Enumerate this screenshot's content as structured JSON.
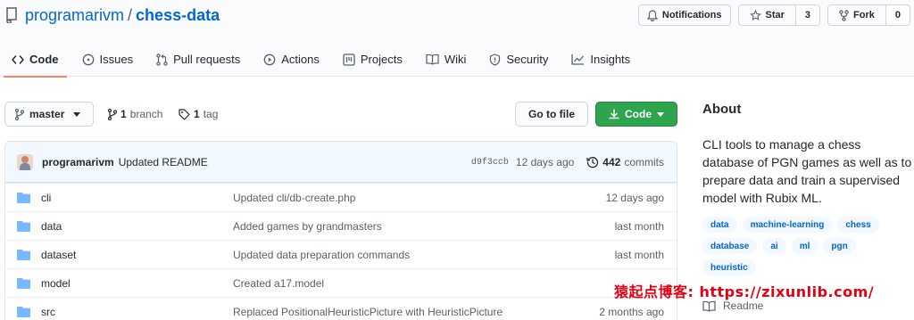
{
  "repo": {
    "owner": "programarivm",
    "separator": "/",
    "name": "chess-data"
  },
  "actions": {
    "notifications_label": "Notifications",
    "star_label": "Star",
    "star_count": "3",
    "fork_label": "Fork",
    "fork_count": "0"
  },
  "tabs": [
    {
      "label": "Code",
      "icon": "code-icon",
      "active": true
    },
    {
      "label": "Issues",
      "icon": "issue-icon"
    },
    {
      "label": "Pull requests",
      "icon": "pull-request-icon"
    },
    {
      "label": "Actions",
      "icon": "play-icon"
    },
    {
      "label": "Projects",
      "icon": "project-icon"
    },
    {
      "label": "Wiki",
      "icon": "book-icon"
    },
    {
      "label": "Security",
      "icon": "shield-icon"
    },
    {
      "label": "Insights",
      "icon": "graph-icon"
    }
  ],
  "toolbar": {
    "branch": "master",
    "branch_count": "1",
    "branch_word": "branch",
    "tag_count": "1",
    "tag_word": "tag",
    "goto_label": "Go to file",
    "code_label": "Code"
  },
  "latest_commit": {
    "user": "programarivm",
    "message": "Updated README",
    "sha": "d9f3ccb",
    "age": "12 days ago",
    "commit_count": "442",
    "commit_word": "commits"
  },
  "files": [
    {
      "name": "cli",
      "message": "Updated cli/db-create.php",
      "age": "12 days ago"
    },
    {
      "name": "data",
      "message": "Added games by grandmasters",
      "age": "last month"
    },
    {
      "name": "dataset",
      "message": "Updated data preparation commands",
      "age": "last month"
    },
    {
      "name": "model",
      "message": "Created a17.model",
      "age": ""
    },
    {
      "name": "src",
      "message": "Replaced PositionalHeuristicPicture with HeuristicPicture",
      "age": "2 months ago"
    }
  ],
  "about": {
    "title": "About",
    "description": "CLI tools to manage a chess database of PGN games as well as to prepare data and train a supervised model with Rubix ML.",
    "topics": [
      "data",
      "machine-learning",
      "chess",
      "database",
      "ai",
      "ml",
      "pgn",
      "heuristic"
    ],
    "readme_label": "Readme"
  },
  "watermark": "猿起点博客: https://zixunlib.com/",
  "colors": {
    "link": "#0366d6",
    "code_button": "#2ea44f",
    "active_tab_underline": "#f9826c",
    "folder": "#79b8ff",
    "watermark": "#e60012"
  }
}
